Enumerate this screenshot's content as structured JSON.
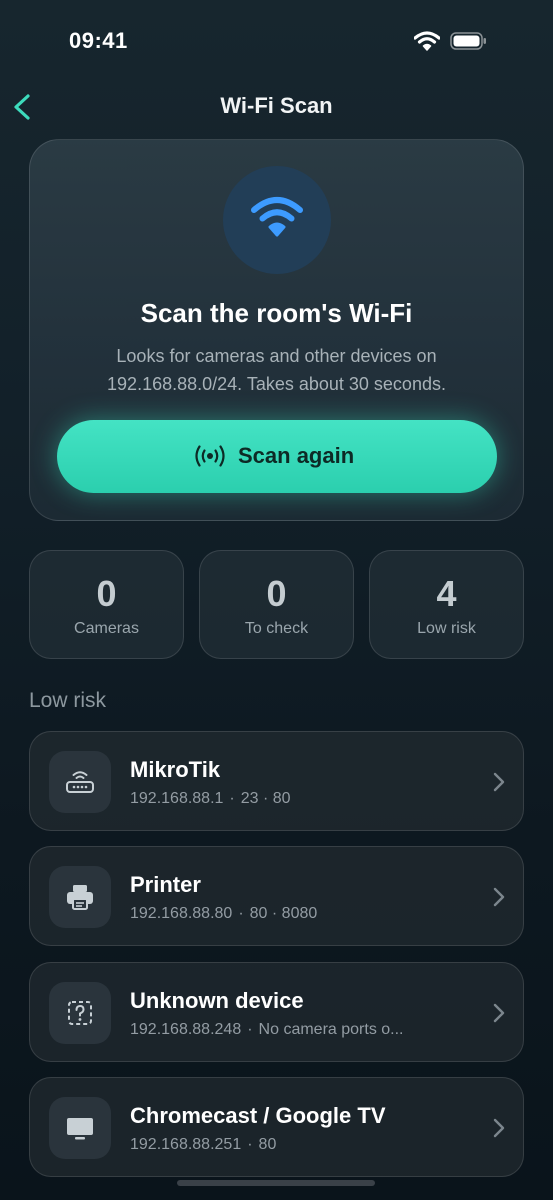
{
  "status_bar": {
    "time": "09:41"
  },
  "nav": {
    "title": "Wi-Fi Scan"
  },
  "scan_card": {
    "title": "Scan the room's Wi-Fi",
    "description": "Looks for cameras and other devices on 192.168.88.0/24. Takes about 30 seconds.",
    "button_label": "Scan again",
    "button_color": "#3ddbbc"
  },
  "stats": [
    {
      "value": "0",
      "label": "Cameras"
    },
    {
      "value": "0",
      "label": "To check"
    },
    {
      "value": "4",
      "label": "Low risk"
    }
  ],
  "section": {
    "heading": "Low risk"
  },
  "devices": [
    {
      "name": "MikroTik",
      "ip": "192.168.88.1",
      "detail": "23 · 80",
      "icon": "router-icon"
    },
    {
      "name": "Printer",
      "ip": "192.168.88.80",
      "detail": "80 · 8080",
      "icon": "printer-icon"
    },
    {
      "name": "Unknown device",
      "ip": "192.168.88.248",
      "detail": "No camera ports o...",
      "icon": "unknown-device-icon"
    },
    {
      "name": "Chromecast / Google TV",
      "ip": "192.168.88.251",
      "detail": "80",
      "icon": "tv-icon"
    }
  ],
  "colors": {
    "accent": "#3ddbbc",
    "wifi_blue": "#3d9bff",
    "background": "#122029"
  }
}
